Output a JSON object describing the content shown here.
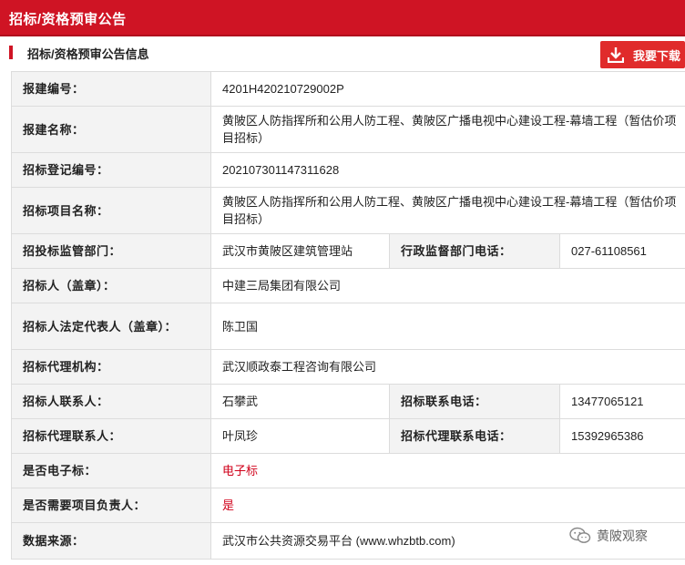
{
  "header": {
    "title": "招标/资格预审公告"
  },
  "section": {
    "title": "招标/资格预审公告信息"
  },
  "download": {
    "label": "我要下载",
    "icon": "download-icon"
  },
  "rows": {
    "r1": {
      "k": "报建编号：",
      "v": "4201H420210729002P"
    },
    "r2": {
      "k": "报建名称：",
      "v": "黄陂区人防指挥所和公用人防工程、黄陂区广播电视中心建设工程-幕墙工程（暂估价项目招标）"
    },
    "r3": {
      "k": "招标登记编号：",
      "v": "20210730114731​1628"
    },
    "r4": {
      "k": "招标项目名称：",
      "v": "黄陂区人防指挥所和公用人防工程、黄陂区广播电视中心建设工程-幕墙工程（暂估价项目招标）"
    },
    "r5": {
      "k": "招投标监管部门：",
      "v": "武汉市黄陂区建筑管理站",
      "k2": "行政监督部门电话：",
      "v2": "027-61108561"
    },
    "r6": {
      "k": "招标人（盖章）：",
      "v": "中建三局集团有限公司"
    },
    "r7": {
      "k": "招标人法定代表人（盖章）：",
      "v": "陈卫国"
    },
    "r8": {
      "k": "招标代理机构：",
      "v": "武汉顺政泰工程咨询有限公司"
    },
    "r9": {
      "k": "招标人联系人：",
      "v": "石攀武",
      "k2": "招标联系电话：",
      "v2": "13477065121"
    },
    "r10": {
      "k": "招标代理联系人：",
      "v": "叶凤珍",
      "k2": "招标代理联系电话：",
      "v2": "15392965386"
    },
    "r11": {
      "k": "是否电子标：",
      "v": "电子标"
    },
    "r12": {
      "k": "是否需要项目负责人：",
      "v": "是"
    },
    "r13": {
      "k": "数据来源：",
      "v": "武汉市公共资源交易平台 (www.whzbtb.com)"
    }
  },
  "colors": {
    "brand": "#cf1424",
    "value_red": "#d0021b"
  },
  "watermark": {
    "text": "黄陂观察",
    "icon": "wechat-icon"
  }
}
